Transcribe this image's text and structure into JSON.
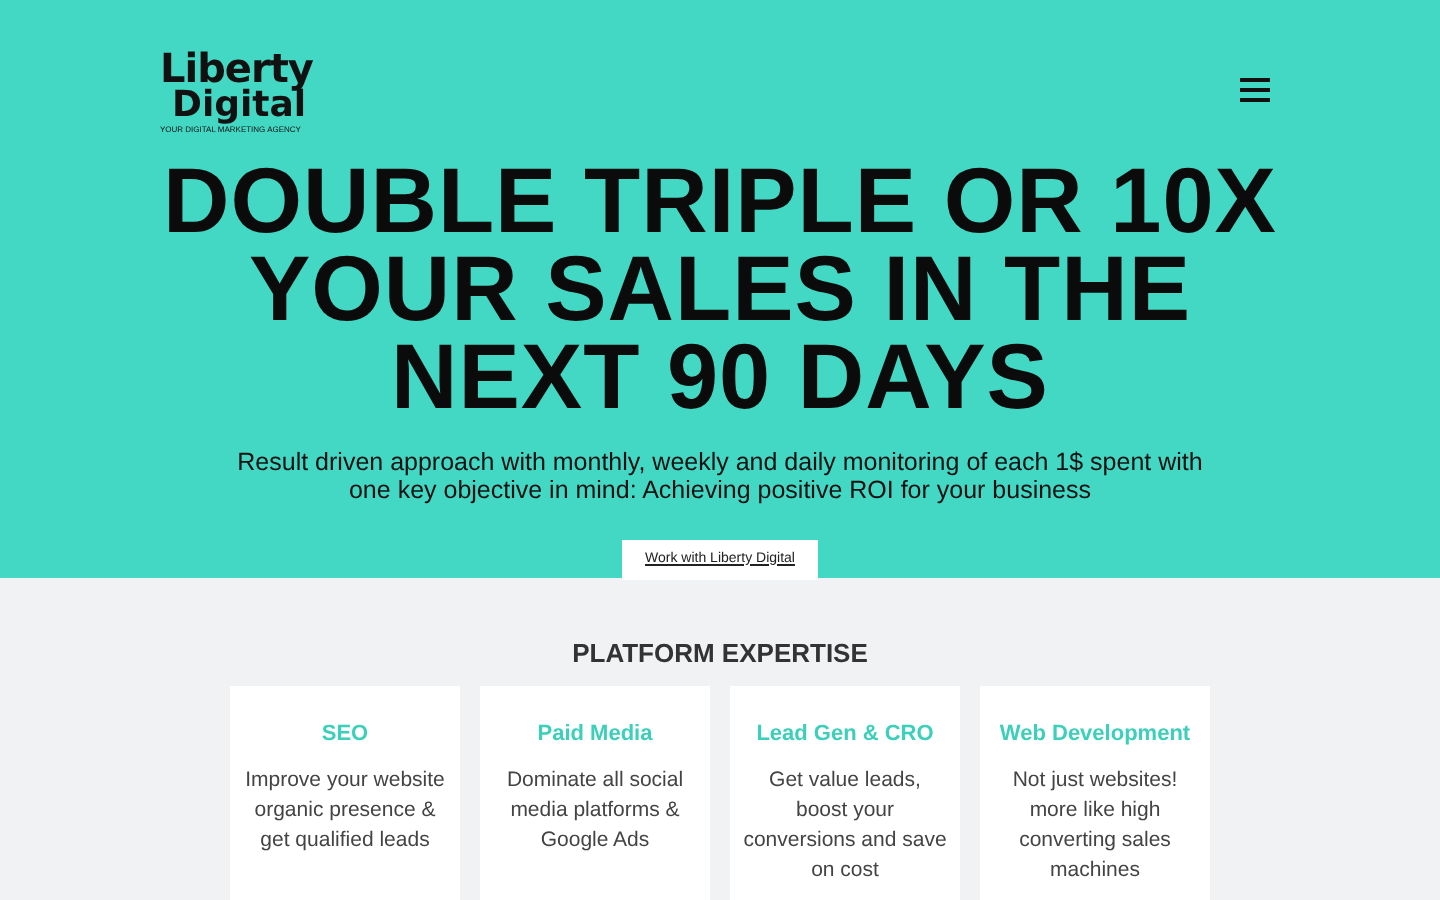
{
  "logo": {
    "name_line_1": "Liberty",
    "name_line_2": "Digital",
    "tagline": "YOUR DIGITAL MARKETING AGENCY"
  },
  "hero": {
    "headline": [
      "DOUBLE TRIPLE OR 10X",
      "YOUR SALES IN THE",
      "NEXT 90 DAYS"
    ],
    "subtitle": "Result driven approach with monthly, weekly and daily monitoring of each 1$ spent with one key objective in mind: Achieving positive ROI for your business",
    "cta": "Work with Liberty Digital"
  },
  "expertise": {
    "title": "PLATFORM EXPERTISE",
    "cards": [
      {
        "title": "SEO",
        "text": "Improve your website organic presence & get qualified leads"
      },
      {
        "title": "Paid Media",
        "text": "Dominate all social media platforms & Google Ads"
      },
      {
        "title": "Lead Gen & CRO",
        "text": "Get value leads, boost your conversions and save on cost"
      },
      {
        "title": "Web Development",
        "text": "Not just websites! more like high converting sales machines"
      }
    ]
  }
}
